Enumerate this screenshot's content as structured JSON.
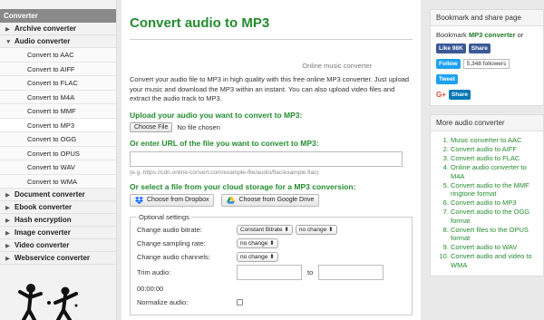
{
  "left_sidebar": {
    "header": "Converter",
    "categories": [
      {
        "label": "Archive converter",
        "expanded": false
      },
      {
        "label": "Audio converter",
        "expanded": true
      }
    ],
    "audio_items": [
      "Convert to AAC",
      "Convert to AIFF",
      "Convert to FLAC",
      "Convert to M4A",
      "Convert to MMF",
      "Convert to MP3",
      "Convert to OGG",
      "Convert to OPUS",
      "Convert to WAV",
      "Convert to WMA"
    ],
    "more_categories": [
      "Document converter",
      "Ebook converter",
      "Hash encryption",
      "Image converter",
      "Video converter",
      "Webservice converter"
    ]
  },
  "main": {
    "title": "Convert audio to MP3",
    "tagline": "Online music converter",
    "intro": "Convert your audio file to MP3 in high quality with this free online MP3 converter. Just upload your music and download the MP3 within an instant. You can also upload video files and extract the audio track to MP3.",
    "upload_title": "Upload your audio you want to convert to MP3:",
    "choose_file_label": "Choose File",
    "no_file_text": "No file chosen",
    "url_title": "Or enter URL of the file you want to convert to MP3:",
    "url_hint": "(e.g. https://cdn.online-convert.com/example-file/audio/flac/example.flac)",
    "cloud_title": "Or select a file from your cloud storage for a MP3 conversion:",
    "dropbox_label": "Choose from Dropbox",
    "gdrive_label": "Choose from Google Drive",
    "optional_settings": {
      "legend": "Optional settings",
      "bitrate_label": "Change audio bitrate:",
      "bitrate_mode": "Constant Bitrate",
      "bitrate_value": "no change",
      "sampling_label": "Change sampling rate:",
      "sampling_value": "no change",
      "channels_label": "Change audio channels:",
      "channels_value": "no change",
      "trim_label": "Trim audio:",
      "trim_to": "to",
      "time_placeholder": "00:00:00",
      "normalize_label": "Normalize audio:"
    }
  },
  "right_sidebar": {
    "bookmark_header": "Bookmark and share page",
    "bookmark_prefix": "Bookmark",
    "bookmark_link": "MP3 converter",
    "bookmark_suffix": "or",
    "fb_like": "Like 98K",
    "fb_share": "Share",
    "tw_follow": "Follow",
    "tw_followers": "5,348 followers",
    "tw_tweet": "Tweet",
    "gplus": "G+",
    "li_share": "Share",
    "more_header": "More audio converter",
    "more_items": [
      "Music converter to AAC",
      "Convert audio to AIFF",
      "Convert audio to FLAC",
      "Online audio converter to M4A",
      "Convert audio to the MMF ringtone format",
      "Convert audio to MP3",
      "Convert audio to the OGG format",
      "Convert files to the OPUS format",
      "Convert audio to WAV",
      "Convert audio and video to WMA"
    ]
  },
  "colors": {
    "accent_green": "#238c2e",
    "facebook": "#3b5998",
    "twitter": "#1da1f2",
    "linkedin": "#0077b5"
  }
}
